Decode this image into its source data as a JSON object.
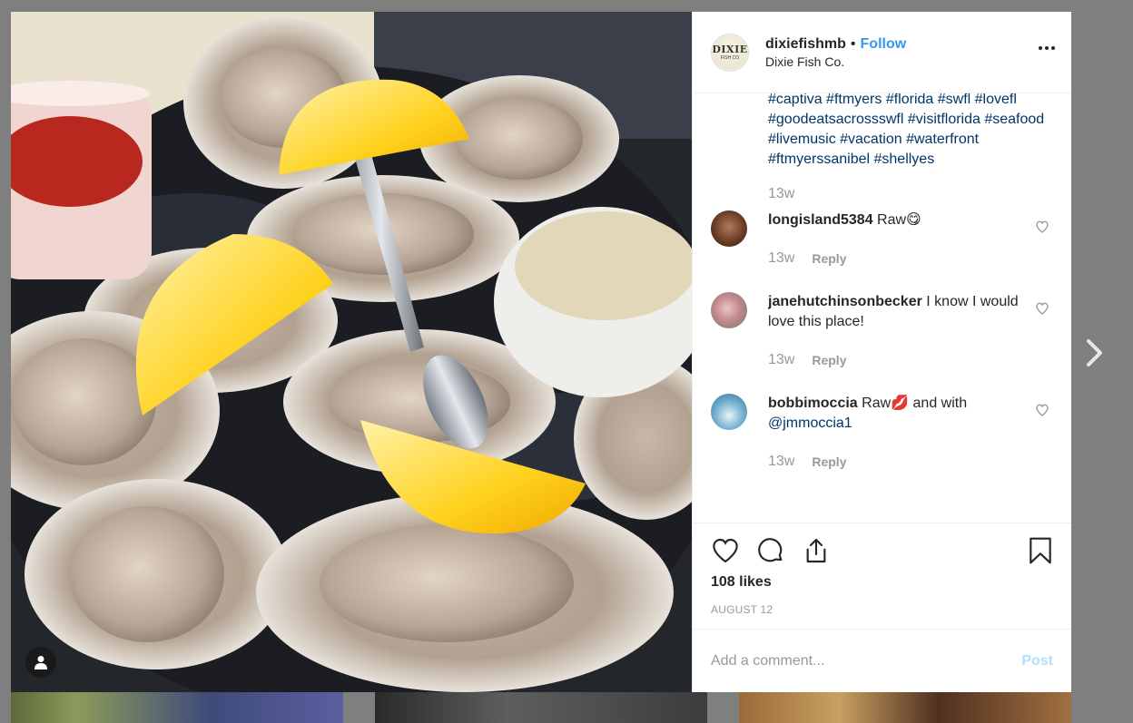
{
  "post": {
    "username": "dixiefishmb",
    "follow_label": "Follow",
    "separator": "•",
    "location": "Dixie Fish Co.",
    "avatar_text": "DIXIE",
    "avatar_subtext": "FISH CO",
    "caption_hashtags": "#captiva #ftmyers #florida #swfl #lovefl #goodeatsacrossswfl #visitflorida #seafood #livemusic #vacation #waterfront #ftmyerssanibel #shellyes",
    "caption_time": "13w",
    "likes": "108 likes",
    "date": "AUGUST 12"
  },
  "comments": [
    {
      "username": "longisland5384",
      "text": "Raw😋",
      "time": "13w",
      "reply": "Reply"
    },
    {
      "username": "janehutchinsonbecker",
      "text": "I know I would love this place!",
      "time": "13w",
      "reply": "Reply"
    },
    {
      "username": "bobbimoccia",
      "text": "Raw💋 and with ",
      "mention": "@jmmoccia1",
      "time": "13w",
      "reply": "Reply"
    }
  ],
  "add_comment": {
    "placeholder": "Add a comment...",
    "post_label": "Post"
  },
  "icons": [
    "heart-icon",
    "comment-icon",
    "share-icon",
    "bookmark-icon",
    "more-options-icon",
    "user-tag-icon",
    "chevron-right-icon"
  ],
  "colors": {
    "link": "#003569",
    "follow": "#3897f0",
    "post_disabled": "#b2dffc",
    "muted": "#999999"
  }
}
